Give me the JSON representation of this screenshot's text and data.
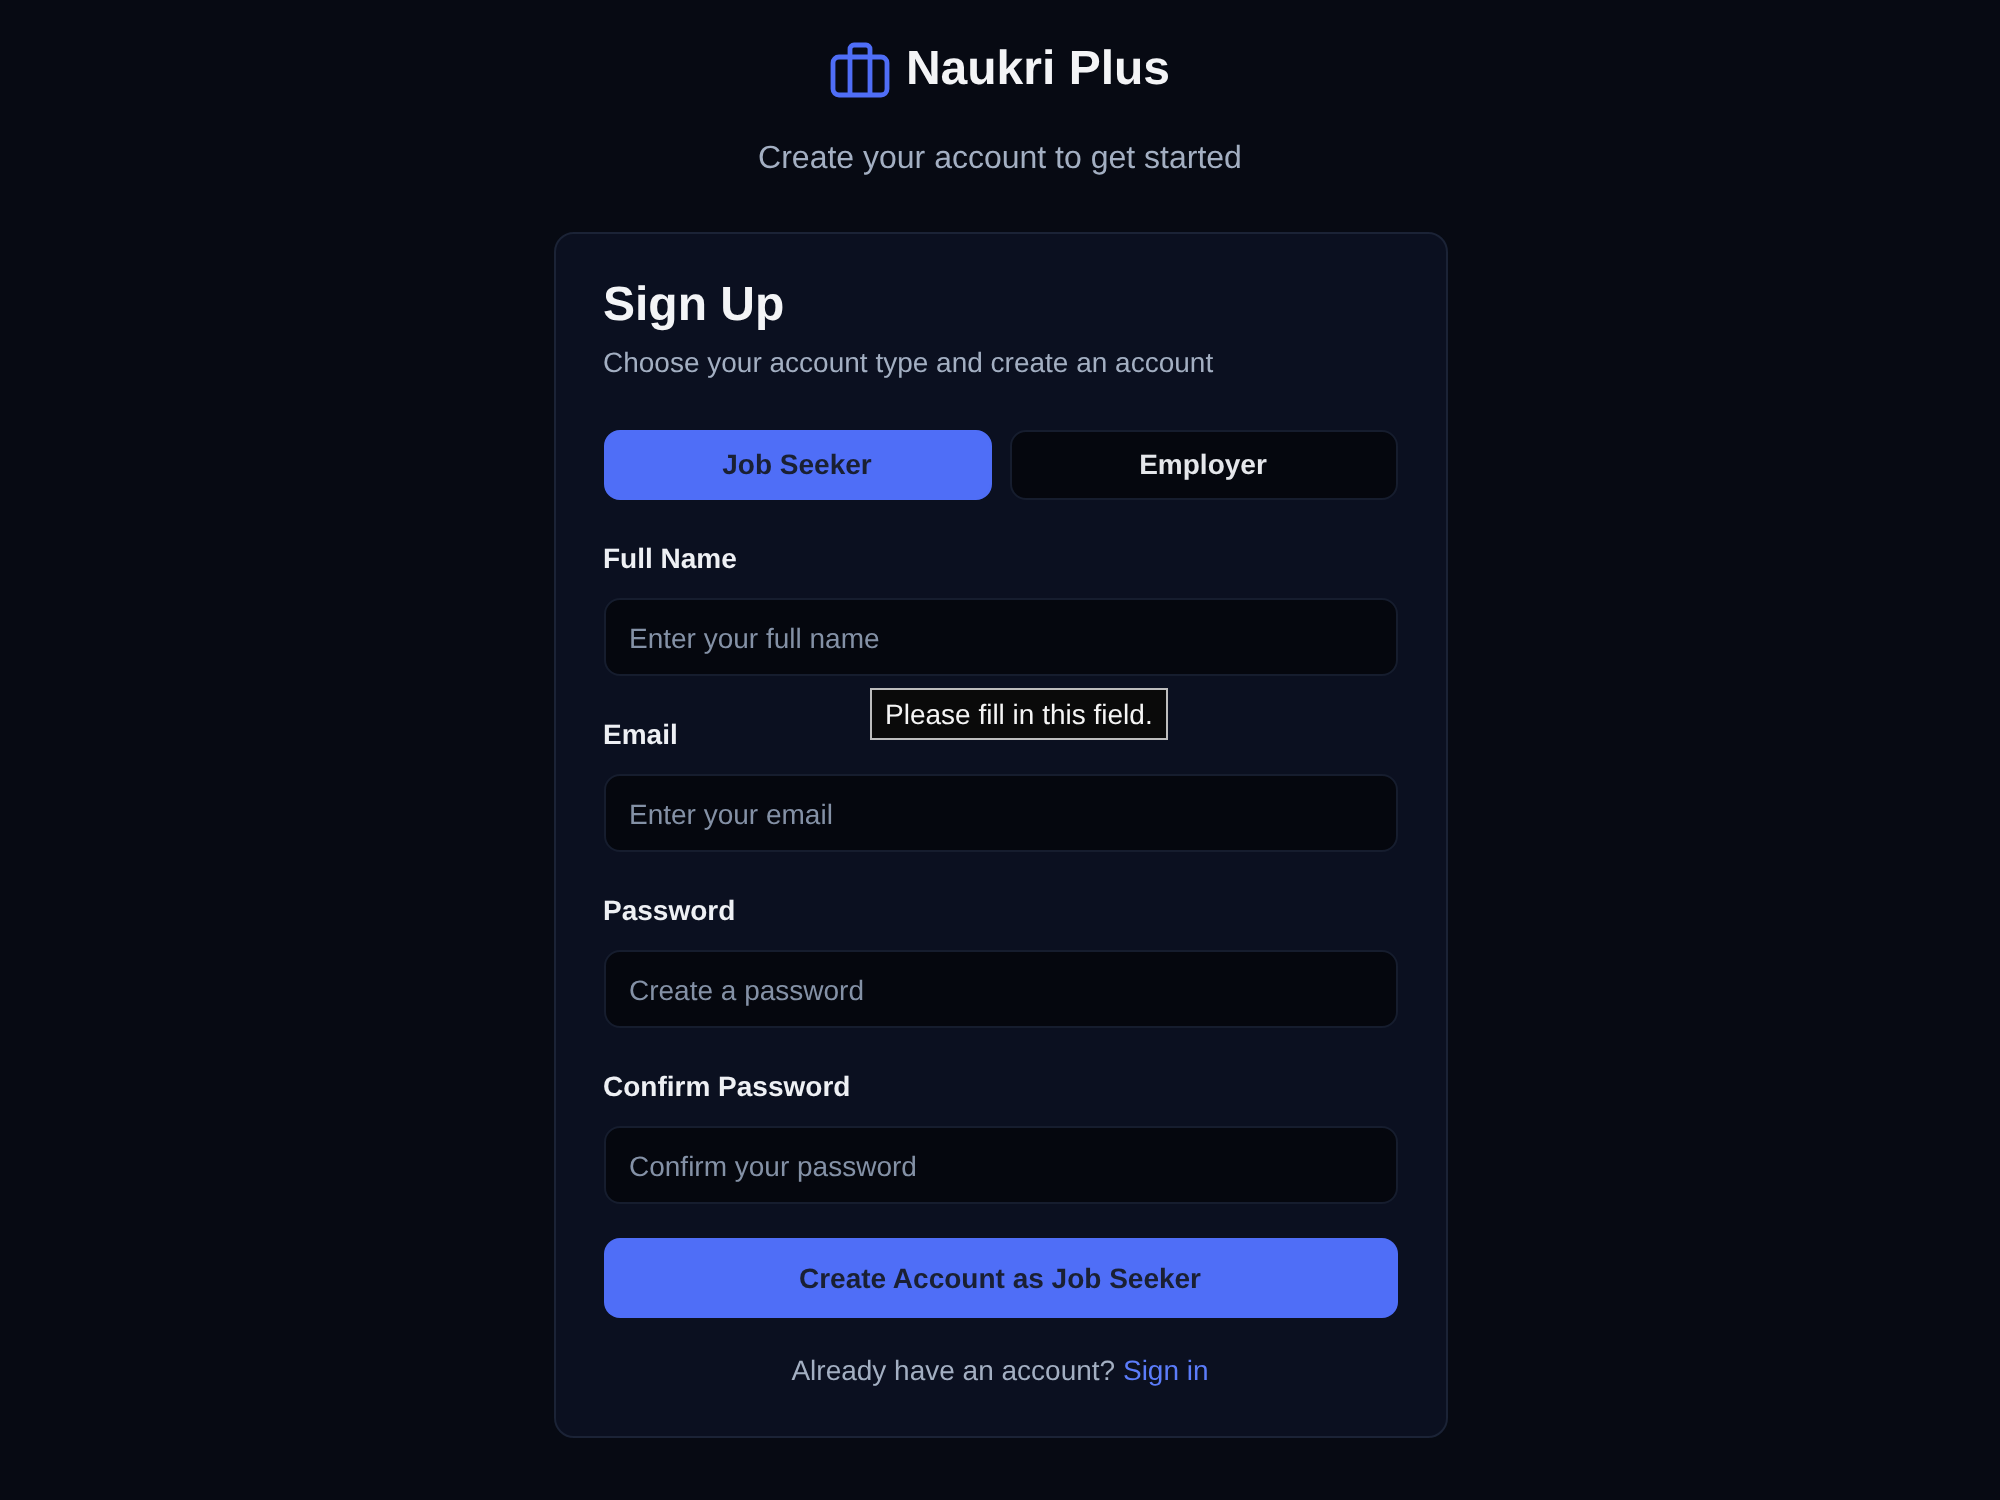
{
  "brand": {
    "name": "Naukri Plus"
  },
  "tagline": "Create your account to get started",
  "card": {
    "title": "Sign Up",
    "subtitle": "Choose your account type and create an account",
    "account_types": [
      {
        "label": "Job Seeker",
        "selected": true
      },
      {
        "label": "Employer",
        "selected": false
      }
    ],
    "fields": [
      {
        "label": "Full Name",
        "placeholder": "Enter your full name",
        "tooltip": "Please fill in this field."
      },
      {
        "label": "Email",
        "placeholder": "Enter your email"
      },
      {
        "label": "Password",
        "placeholder": "Create a password"
      },
      {
        "label": "Confirm Password",
        "placeholder": "Confirm your password"
      }
    ],
    "submit": "Create Account as Job Seeker",
    "footer": {
      "text": "Already have an account?",
      "link": "Sign in"
    }
  }
}
